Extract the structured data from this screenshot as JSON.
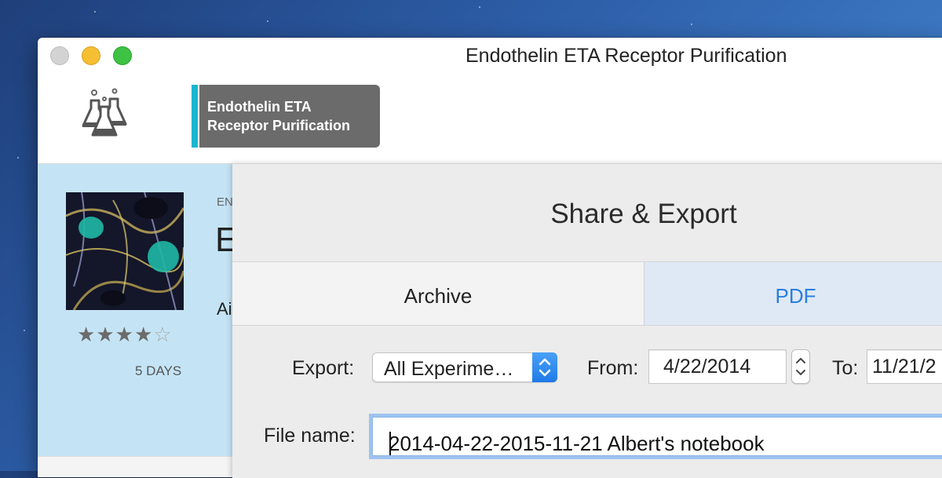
{
  "window": {
    "title": "Endothelin ETA Receptor Purification"
  },
  "toolbar": {
    "project_tab_line1": "Endothelin ETA",
    "project_tab_line2": "Receptor Purification",
    "icon": "lab-flasks-icon"
  },
  "experiment": {
    "peek_small": "EN",
    "peek_big": "E",
    "peek_line": "Ai",
    "rating": 4,
    "rating_max": 5,
    "duration": "5 DAYS"
  },
  "sheet": {
    "title": "Share & Export",
    "tabs": [
      {
        "label": "Archive",
        "selected": false
      },
      {
        "label": "PDF",
        "selected": true
      }
    ],
    "export_label": "Export:",
    "export_value": "All Experime…",
    "from_label": "From:",
    "from_value": "4/22/2014",
    "to_label": "To:",
    "to_value": "11/21/2",
    "filename_label": "File name:",
    "filename_value": "2014-04-22-2015-11-21 Albert's notebook"
  },
  "colors": {
    "accent_blue": "#2a7de1",
    "project_stripe": "#1ab6cf",
    "content_bg": "#c4e4f5",
    "popup_blue": "#1f7ae8"
  }
}
